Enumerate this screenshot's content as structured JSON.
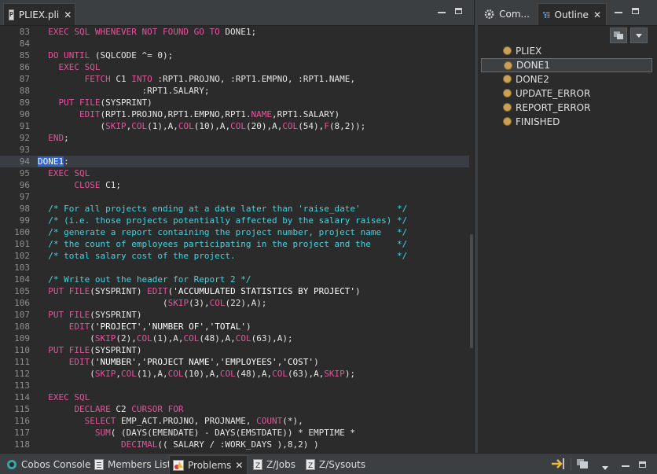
{
  "editor": {
    "tab_label": "PLIEX.pli",
    "tab_icon": "P",
    "lines": [
      {
        "n": "83",
        "segs": [
          [
            "plain",
            "  "
          ],
          [
            "kw",
            "EXEC SQL WHENEVER NOT FOUND GO TO"
          ],
          [
            "plain",
            " DONE1;"
          ]
        ]
      },
      {
        "n": "84",
        "segs": []
      },
      {
        "n": "85",
        "segs": [
          [
            "plain",
            "  "
          ],
          [
            "kw",
            "DO UNTIL"
          ],
          [
            "plain",
            " (SQLCODE ^= 0);"
          ]
        ]
      },
      {
        "n": "86",
        "segs": [
          [
            "plain",
            "    "
          ],
          [
            "kw",
            "EXEC SQL"
          ]
        ]
      },
      {
        "n": "87",
        "segs": [
          [
            "plain",
            "         "
          ],
          [
            "kw",
            "FETCH"
          ],
          [
            "plain",
            " C1 "
          ],
          [
            "kw",
            "INTO"
          ],
          [
            "plain",
            " :RPT1.PROJNO, :RPT1.EMPNO, :RPT1.NAME,"
          ]
        ]
      },
      {
        "n": "88",
        "segs": [
          [
            "plain",
            "                    :RPT1.SALARY;"
          ]
        ]
      },
      {
        "n": "89",
        "segs": [
          [
            "plain",
            "    "
          ],
          [
            "kw",
            "PUT FILE"
          ],
          [
            "plain",
            "(SYSPRINT)"
          ]
        ]
      },
      {
        "n": "90",
        "segs": [
          [
            "plain",
            "        "
          ],
          [
            "kw",
            "EDIT"
          ],
          [
            "plain",
            "(RPT1.PROJNO,RPT1.EMPNO,RPT1."
          ],
          [
            "kw",
            "NAME"
          ],
          [
            "plain",
            ",RPT1.SALARY)"
          ]
        ]
      },
      {
        "n": "91",
        "segs": [
          [
            "plain",
            "            ("
          ],
          [
            "kw",
            "SKIP"
          ],
          [
            "plain",
            ","
          ],
          [
            "kw",
            "COL"
          ],
          [
            "plain",
            "(1),A,"
          ],
          [
            "kw",
            "COL"
          ],
          [
            "plain",
            "(10),A,"
          ],
          [
            "kw",
            "COL"
          ],
          [
            "plain",
            "(20),A,"
          ],
          [
            "kw",
            "COL"
          ],
          [
            "plain",
            "(54),"
          ],
          [
            "kw",
            "F"
          ],
          [
            "plain",
            "(8,2));"
          ]
        ]
      },
      {
        "n": "92",
        "segs": [
          [
            "plain",
            "  "
          ],
          [
            "kw",
            "END"
          ],
          [
            "plain",
            ";"
          ]
        ]
      },
      {
        "n": "93",
        "segs": []
      },
      {
        "n": "94",
        "current": true,
        "segs": [
          [
            "sel",
            "DONE1"
          ],
          [
            "plain",
            ":"
          ]
        ]
      },
      {
        "n": "95",
        "segs": [
          [
            "plain",
            "  "
          ],
          [
            "kw",
            "EXEC SQL"
          ]
        ]
      },
      {
        "n": "96",
        "segs": [
          [
            "plain",
            "       "
          ],
          [
            "kw",
            "CLOSE"
          ],
          [
            "plain",
            " C1;"
          ]
        ]
      },
      {
        "n": "97",
        "segs": []
      },
      {
        "n": "98",
        "segs": [
          [
            "cmt",
            "  /* For all projects ending at a date later than 'raise_date'       */"
          ]
        ]
      },
      {
        "n": "99",
        "segs": [
          [
            "cmt",
            "  /* (i.e. those projects potentially affected by the salary raises) */"
          ]
        ]
      },
      {
        "n": "100",
        "segs": [
          [
            "cmt",
            "  /* generate a report containing the project number, project name   */"
          ]
        ]
      },
      {
        "n": "101",
        "segs": [
          [
            "cmt",
            "  /* the count of employees participating in the project and the     */"
          ]
        ]
      },
      {
        "n": "102",
        "segs": [
          [
            "cmt",
            "  /* total salary cost of the project.                               */"
          ]
        ]
      },
      {
        "n": "103",
        "segs": []
      },
      {
        "n": "104",
        "segs": [
          [
            "cmt",
            "  /* Write out the header for Report 2 */"
          ]
        ]
      },
      {
        "n": "105",
        "segs": [
          [
            "plain",
            "  "
          ],
          [
            "kw",
            "PUT FILE"
          ],
          [
            "plain",
            "(SYSPRINT) "
          ],
          [
            "kw",
            "EDIT"
          ],
          [
            "plain",
            "("
          ],
          [
            "str",
            "'ACCUMULATED STATISTICS BY PROJECT'"
          ],
          [
            "plain",
            ")"
          ]
        ]
      },
      {
        "n": "106",
        "segs": [
          [
            "plain",
            "                        ("
          ],
          [
            "kw",
            "SKIP"
          ],
          [
            "plain",
            "(3),"
          ],
          [
            "kw",
            "COL"
          ],
          [
            "plain",
            "(22),A);"
          ]
        ]
      },
      {
        "n": "107",
        "segs": [
          [
            "plain",
            "  "
          ],
          [
            "kw",
            "PUT FILE"
          ],
          [
            "plain",
            "(SYSPRINT)"
          ]
        ]
      },
      {
        "n": "108",
        "segs": [
          [
            "plain",
            "      "
          ],
          [
            "kw",
            "EDIT"
          ],
          [
            "plain",
            "("
          ],
          [
            "str",
            "'PROJECT'"
          ],
          [
            "plain",
            ","
          ],
          [
            "str",
            "'NUMBER OF'"
          ],
          [
            "plain",
            ","
          ],
          [
            "str",
            "'TOTAL'"
          ],
          [
            "plain",
            ")"
          ]
        ]
      },
      {
        "n": "109",
        "segs": [
          [
            "plain",
            "          ("
          ],
          [
            "kw",
            "SKIP"
          ],
          [
            "plain",
            "(2),"
          ],
          [
            "kw",
            "COL"
          ],
          [
            "plain",
            "(1),A,"
          ],
          [
            "kw",
            "COL"
          ],
          [
            "plain",
            "(48),A,"
          ],
          [
            "kw",
            "COL"
          ],
          [
            "plain",
            "(63),A);"
          ]
        ]
      },
      {
        "n": "110",
        "segs": [
          [
            "plain",
            "  "
          ],
          [
            "kw",
            "PUT FILE"
          ],
          [
            "plain",
            "(SYSPRINT)"
          ]
        ]
      },
      {
        "n": "111",
        "segs": [
          [
            "plain",
            "      "
          ],
          [
            "kw",
            "EDIT"
          ],
          [
            "plain",
            "("
          ],
          [
            "str",
            "'NUMBER'"
          ],
          [
            "plain",
            ","
          ],
          [
            "str",
            "'PROJECT NAME'"
          ],
          [
            "plain",
            ","
          ],
          [
            "str",
            "'EMPLOYEES'"
          ],
          [
            "plain",
            ","
          ],
          [
            "str",
            "'COST'"
          ],
          [
            "plain",
            ")"
          ]
        ]
      },
      {
        "n": "112",
        "segs": [
          [
            "plain",
            "          ("
          ],
          [
            "kw",
            "SKIP"
          ],
          [
            "plain",
            ","
          ],
          [
            "kw",
            "COL"
          ],
          [
            "plain",
            "(1),A,"
          ],
          [
            "kw",
            "COL"
          ],
          [
            "plain",
            "(10),A,"
          ],
          [
            "kw",
            "COL"
          ],
          [
            "plain",
            "(48),A,"
          ],
          [
            "kw",
            "COL"
          ],
          [
            "plain",
            "(63),A,"
          ],
          [
            "kw",
            "SKIP"
          ],
          [
            "plain",
            ");"
          ]
        ]
      },
      {
        "n": "113",
        "segs": []
      },
      {
        "n": "114",
        "segs": [
          [
            "plain",
            "  "
          ],
          [
            "kw",
            "EXEC SQL"
          ]
        ]
      },
      {
        "n": "115",
        "segs": [
          [
            "plain",
            "       "
          ],
          [
            "kw",
            "DECLARE"
          ],
          [
            "plain",
            " C2 "
          ],
          [
            "kw",
            "CURSOR FOR"
          ]
        ]
      },
      {
        "n": "116",
        "segs": [
          [
            "plain",
            "         "
          ],
          [
            "kw",
            "SELECT"
          ],
          [
            "plain",
            " EMP_ACT.PROJNO, PROJNAME, "
          ],
          [
            "kw",
            "COUNT"
          ],
          [
            "plain",
            "(*),"
          ]
        ]
      },
      {
        "n": "117",
        "segs": [
          [
            "plain",
            "           "
          ],
          [
            "kw",
            "SUM"
          ],
          [
            "plain",
            "( (DAYS(EMENDATE) - DAYS(EMSTDATE)) * EMPTIME *"
          ]
        ]
      },
      {
        "n": "118",
        "segs": [
          [
            "plain",
            "                "
          ],
          [
            "kw",
            "DECIMAL"
          ],
          [
            "plain",
            "(( SALARY / :WORK_DAYS ),8,2) )"
          ]
        ]
      }
    ]
  },
  "right_panel": {
    "tabs": [
      {
        "label": "Com...",
        "icon": "gear-icon"
      },
      {
        "label": "Outline",
        "icon": "outline-icon"
      }
    ],
    "outline_items": [
      {
        "label": "PLIEX",
        "selected": false
      },
      {
        "label": "DONE1",
        "selected": true
      },
      {
        "label": "DONE2",
        "selected": false
      },
      {
        "label": "UPDATE_ERROR",
        "selected": false
      },
      {
        "label": "REPORT_ERROR",
        "selected": false
      },
      {
        "label": "FINISHED",
        "selected": false
      }
    ]
  },
  "bottom_tabs": [
    {
      "label": "Cobos Console",
      "icon": "console-icon",
      "active": false
    },
    {
      "label": "Members List",
      "icon": "list-icon",
      "active": false
    },
    {
      "label": "Problems",
      "icon": "problems-icon",
      "active": true
    },
    {
      "label": "Z/Jobs",
      "icon": "jobs-icon",
      "active": false
    },
    {
      "label": "Z/Sysouts",
      "icon": "sysouts-icon",
      "active": false
    }
  ],
  "colors": {
    "keyword": "#e0569a",
    "comment": "#43d4e0",
    "selection": "#2f65ca"
  }
}
